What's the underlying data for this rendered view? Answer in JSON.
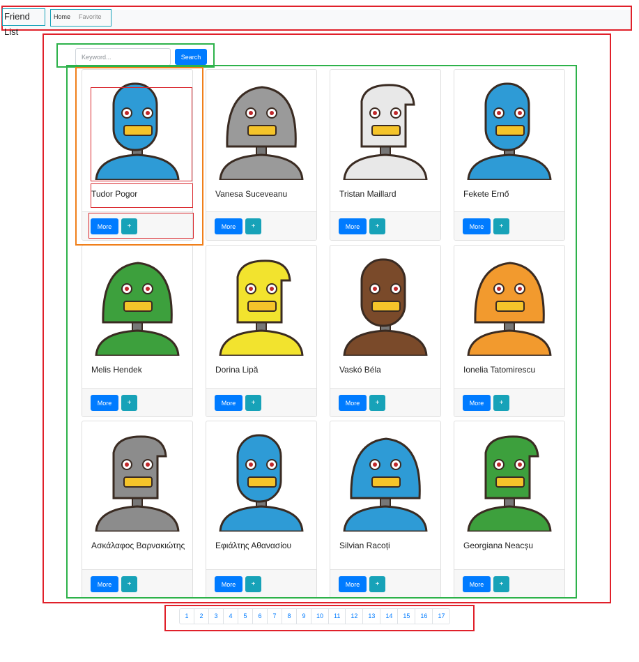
{
  "navbar": {
    "brand": "Friend List",
    "links": [
      "Home",
      "Favorite"
    ]
  },
  "search": {
    "placeholder": "Keyword...",
    "button_label": "Search"
  },
  "card_actions": {
    "more_label": "More",
    "add_label": "+"
  },
  "friends": [
    {
      "name": "Tudor Pogor",
      "avatar": "robot-avatar",
      "color": "#2e9bd6"
    },
    {
      "name": "Vanesa Suceveanu",
      "avatar": "robot-avatar",
      "color": "#9a9a9a"
    },
    {
      "name": "Tristan Maillard",
      "avatar": "robot-avatar",
      "color": "#e8e8e8"
    },
    {
      "name": "Fekete Ernő",
      "avatar": "robot-avatar",
      "color": "#2e9bd6"
    },
    {
      "name": "Melis Hendek",
      "avatar": "robot-avatar",
      "color": "#3da03d"
    },
    {
      "name": "Dorina Lipă",
      "avatar": "robot-avatar",
      "color": "#f2e32e"
    },
    {
      "name": "Vaskó Béla",
      "avatar": "robot-avatar",
      "color": "#7a4a2a"
    },
    {
      "name": "Ionelia Tatomirescu",
      "avatar": "robot-avatar",
      "color": "#f29a2e"
    },
    {
      "name": "Ασκάλαφος Βαρνακιώτης",
      "avatar": "robot-avatar",
      "color": "#8c8c8c"
    },
    {
      "name": "Εφιάλτης Αθανασίου",
      "avatar": "robot-avatar",
      "color": "#2e9bd6"
    },
    {
      "name": "Silvian Racoți",
      "avatar": "robot-avatar",
      "color": "#2e9bd6"
    },
    {
      "name": "Georgiana Neacșu",
      "avatar": "robot-avatar",
      "color": "#3da03d"
    }
  ],
  "pagination": {
    "pages": [
      "1",
      "2",
      "3",
      "4",
      "5",
      "6",
      "7",
      "8",
      "9",
      "10",
      "11",
      "12",
      "13",
      "14",
      "15",
      "16",
      "17"
    ]
  }
}
